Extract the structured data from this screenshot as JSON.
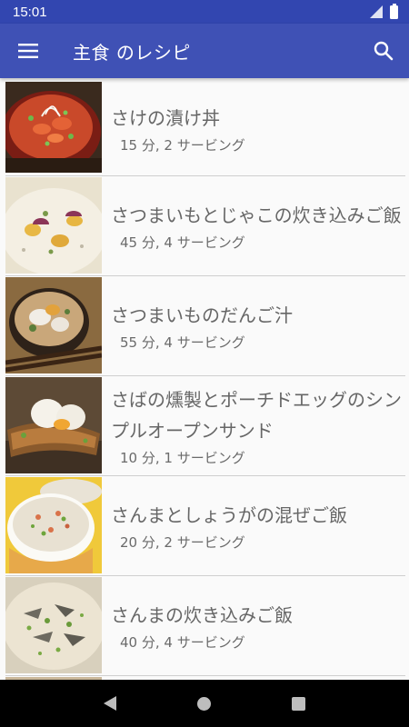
{
  "status_bar": {
    "time": "15:01"
  },
  "app_bar": {
    "title": "主食 のレシピ"
  },
  "recipes": [
    {
      "title": "さけの漬け丼",
      "meta": "15 分, 2 サービング"
    },
    {
      "title": "さつまいもとじゃこの炊き込みご飯",
      "meta": "45 分, 4 サービング"
    },
    {
      "title": "さつまいものだんご汁",
      "meta": "55 分, 4 サービング"
    },
    {
      "title": "さばの燻製とポーチドエッグのシンプルオープンサンド",
      "meta": "10 分, 1 サービング"
    },
    {
      "title": "さんまとしょうがの混ぜご飯",
      "meta": "20 分, 2 サービング"
    },
    {
      "title": "さんまの炊き込みご飯",
      "meta": "40 分, 4 サービング"
    }
  ],
  "colors": {
    "primary": "#3f51b5",
    "status_bar": "#3246b0"
  }
}
